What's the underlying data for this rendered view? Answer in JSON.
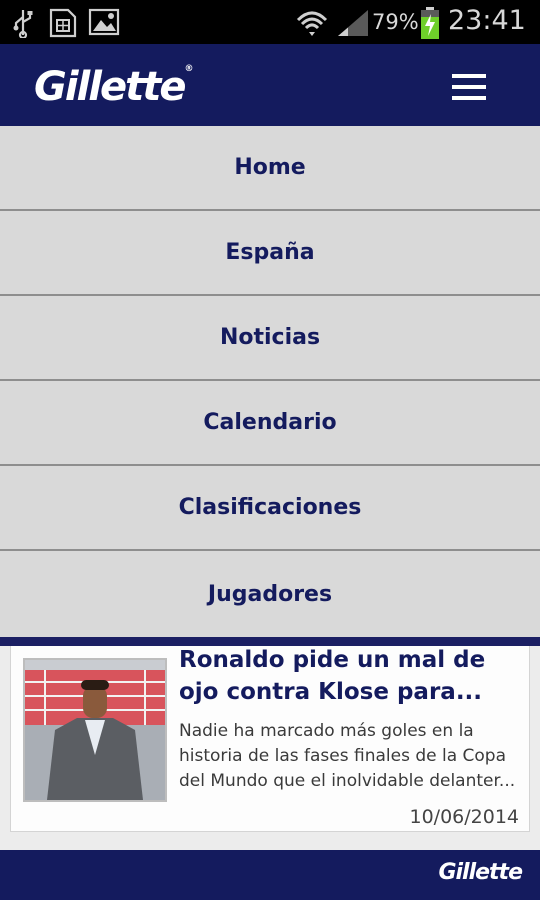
{
  "status_bar": {
    "battery": "79%",
    "time": "23:41"
  },
  "header": {
    "logo": "Gillette",
    "menu_icon": "hamburger-icon"
  },
  "menu": {
    "items": [
      {
        "label": "Home"
      },
      {
        "label": "España"
      },
      {
        "label": "Noticias"
      },
      {
        "label": "Calendario"
      },
      {
        "label": "Clasificaciones"
      },
      {
        "label": "Jugadores"
      }
    ]
  },
  "news": {
    "title": "Ronaldo pide un mal de ojo contra Klose para...",
    "summary": "Nadie ha marcado más goles en la historia de las fases finales de la Copa del Mundo que el inolvidable delanter...",
    "date": "10/06/2014"
  },
  "footer": {
    "logo": "Gillette"
  },
  "colors": {
    "brand": "#141b5e",
    "menu_bg": "#d9d9d9"
  }
}
